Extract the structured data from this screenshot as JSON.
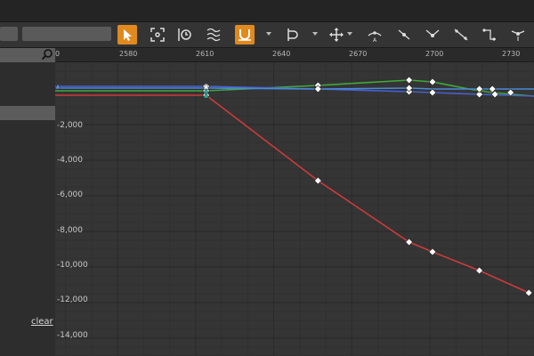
{
  "toolbar": {
    "tools": [
      {
        "name": "select-tool",
        "icon": "arrow-cursor-icon",
        "active": true
      },
      {
        "name": "frame-all-tool",
        "icon": "frame-icon",
        "active": false
      },
      {
        "name": "time-tool",
        "icon": "clock-icon",
        "active": false
      },
      {
        "name": "wave-tool",
        "icon": "wave-icon",
        "active": false
      },
      {
        "name": "snap-tool",
        "icon": "magnet-icon",
        "active": true
      },
      {
        "name": "clamp-tool",
        "icon": "bracket-icon",
        "active": false
      },
      {
        "name": "transform-tool",
        "icon": "move-icon",
        "active": false
      },
      {
        "name": "auto-tangent",
        "icon": "auto-tangent-icon",
        "active": false
      },
      {
        "name": "user-tangent",
        "icon": "user-tangent-icon",
        "active": false
      },
      {
        "name": "break-tangent",
        "icon": "break-tangent-icon",
        "active": false
      },
      {
        "name": "linear-tangent",
        "icon": "linear-tangent-icon",
        "active": false
      },
      {
        "name": "constant-tangent",
        "icon": "constant-tangent-icon",
        "active": false
      },
      {
        "name": "flatten-tangent",
        "icon": "flatten-tangent-icon",
        "active": false
      }
    ]
  },
  "left_panel": {
    "clear_label": "clear"
  },
  "ruler": {
    "ticks": [
      "0",
      "2580",
      "2610",
      "2640",
      "2670",
      "2700",
      "2730"
    ]
  },
  "y_axis": {
    "ticks": [
      "-2,000",
      "-4,000",
      "-6,000",
      "-8,000",
      "-10,000",
      "-12,000",
      "-14,000"
    ]
  },
  "chart_data": {
    "type": "line",
    "x_range": [
      2556,
      2740
    ],
    "y_range": [
      -15000,
      1500
    ],
    "series": [
      {
        "color": "#cc3b3b",
        "points": [
          [
            2556,
            -350
          ],
          [
            2614,
            -350
          ],
          [
            2657,
            -5150
          ],
          [
            2692,
            -8600
          ],
          [
            2701,
            -9150
          ],
          [
            2719,
            -10200
          ],
          [
            2738,
            -11450
          ]
        ]
      },
      {
        "color": "#3faa3a",
        "points": [
          [
            2556,
            -100
          ],
          [
            2614,
            -100
          ],
          [
            2657,
            200
          ],
          [
            2692,
            500
          ],
          [
            2701,
            400
          ],
          [
            2715,
            0
          ],
          [
            2724,
            -200
          ],
          [
            2740,
            -400
          ]
        ]
      },
      {
        "color": "#4a5fcf",
        "points": [
          [
            2556,
            150
          ],
          [
            2614,
            150
          ],
          [
            2657,
            0
          ],
          [
            2692,
            -150
          ],
          [
            2701,
            -200
          ],
          [
            2719,
            -300
          ],
          [
            2740,
            -400
          ]
        ]
      },
      {
        "color": "#4a8ad6",
        "points": [
          [
            2556,
            50
          ],
          [
            2614,
            50
          ],
          [
            2657,
            0
          ],
          [
            2692,
            50
          ],
          [
            2701,
            0
          ],
          [
            2725,
            0
          ],
          [
            2740,
            0
          ]
        ]
      }
    ],
    "keys": [
      [
        2614,
        -100
      ],
      [
        2614,
        150
      ],
      [
        2614,
        -350
      ],
      [
        2657,
        200
      ],
      [
        2657,
        0
      ],
      [
        2692,
        500
      ],
      [
        2692,
        -150
      ],
      [
        2692,
        50
      ],
      [
        2701,
        400
      ],
      [
        2701,
        -200
      ],
      [
        2719,
        -300
      ],
      [
        2719,
        -10200
      ],
      [
        2719,
        0
      ],
      [
        2724,
        0
      ],
      [
        2725,
        -300
      ],
      [
        2731,
        -200
      ],
      [
        2657,
        -5150
      ],
      [
        2692,
        -8600
      ],
      [
        2701,
        -9150
      ],
      [
        2738,
        -11450
      ]
    ]
  }
}
